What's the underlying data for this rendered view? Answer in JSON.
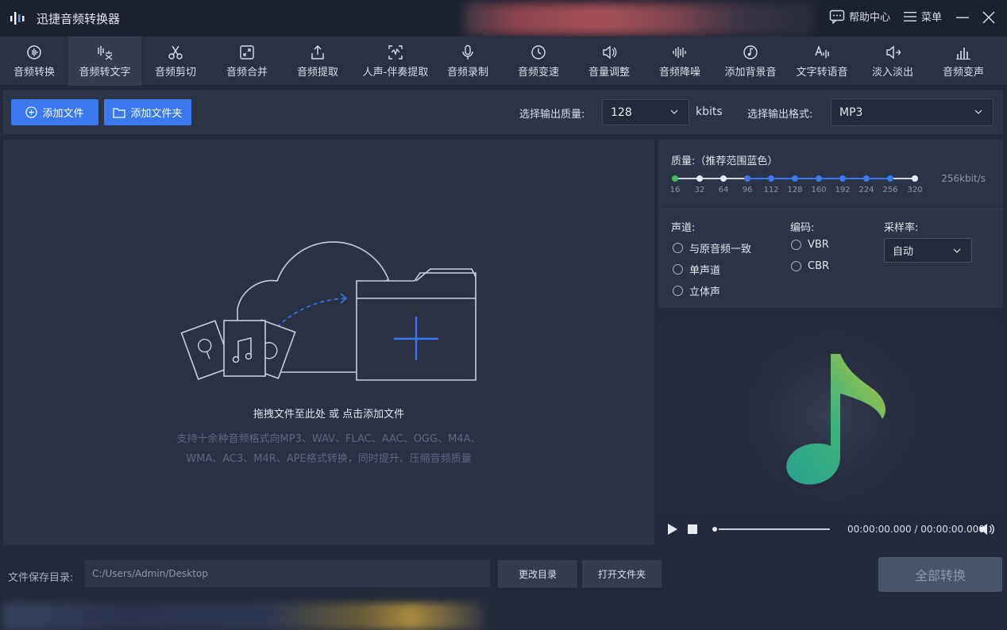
{
  "app": {
    "title": "迅捷音频转换器"
  },
  "titlebar": {
    "help_label": "帮助中心",
    "menu_label": "菜单"
  },
  "tools": [
    {
      "label": "音频转换",
      "icon": "audio-convert-icon"
    },
    {
      "label": "音频转文字",
      "icon": "speech-to-text-icon"
    },
    {
      "label": "音频剪切",
      "icon": "scissors-icon"
    },
    {
      "label": "音频合并",
      "icon": "merge-icon"
    },
    {
      "label": "音频提取",
      "icon": "extract-icon"
    },
    {
      "label": "人声-伴奏提取",
      "icon": "vocal-separate-icon"
    },
    {
      "label": "音频录制",
      "icon": "microphone-icon"
    },
    {
      "label": "音频变速",
      "icon": "speed-icon"
    },
    {
      "label": "音量调整",
      "icon": "volume-icon"
    },
    {
      "label": "音频降噪",
      "icon": "denoise-icon"
    },
    {
      "label": "添加背景音",
      "icon": "background-music-icon"
    },
    {
      "label": "文字转语音",
      "icon": "text-to-speech-icon"
    },
    {
      "label": "淡入淡出",
      "icon": "fade-icon"
    },
    {
      "label": "音频变声",
      "icon": "voice-change-icon"
    }
  ],
  "actions": {
    "add_file": "添加文件",
    "add_folder": "添加文件夹",
    "quality_label": "选择输出质量:",
    "quality_value": "128",
    "quality_unit": "kbits",
    "format_label": "选择输出格式:",
    "format_value": "MP3"
  },
  "drop": {
    "main": "拖拽文件至此处 或 点击添加文件",
    "sub_line1": "支持十余种音频格式向MP3、WAV、FLAC、AAC、OGG、M4A、",
    "sub_line2": "WMA、AC3、M4R、APE格式转换，同时提升、压缩音频质量"
  },
  "settings": {
    "quality_title": "质量:（推荐范围蓝色）",
    "quality_ticks": [
      "16",
      "32",
      "64",
      "96",
      "112",
      "128",
      "160",
      "192",
      "224",
      "256",
      "320"
    ],
    "quality_current": "256kbit/s",
    "channel_title": "声道:",
    "channels": [
      "与原音频一致",
      "单声道",
      "立体声"
    ],
    "encoding_title": "编码:",
    "encodings": [
      "VBR",
      "CBR"
    ],
    "sample_title": "采样率:",
    "sample_value": "自动"
  },
  "player": {
    "time": "00:00:00.000 / 00:00:00.000"
  },
  "bottom": {
    "save_label": "文件保存目录:",
    "save_path": "C:/Users/Admin/Desktop",
    "change_dir": "更改目录",
    "open_folder": "打开文件夹",
    "convert_all": "全部转换"
  },
  "colors": {
    "accent": "#3a78f0",
    "background": "#232939",
    "panel": "#2c3447"
  }
}
